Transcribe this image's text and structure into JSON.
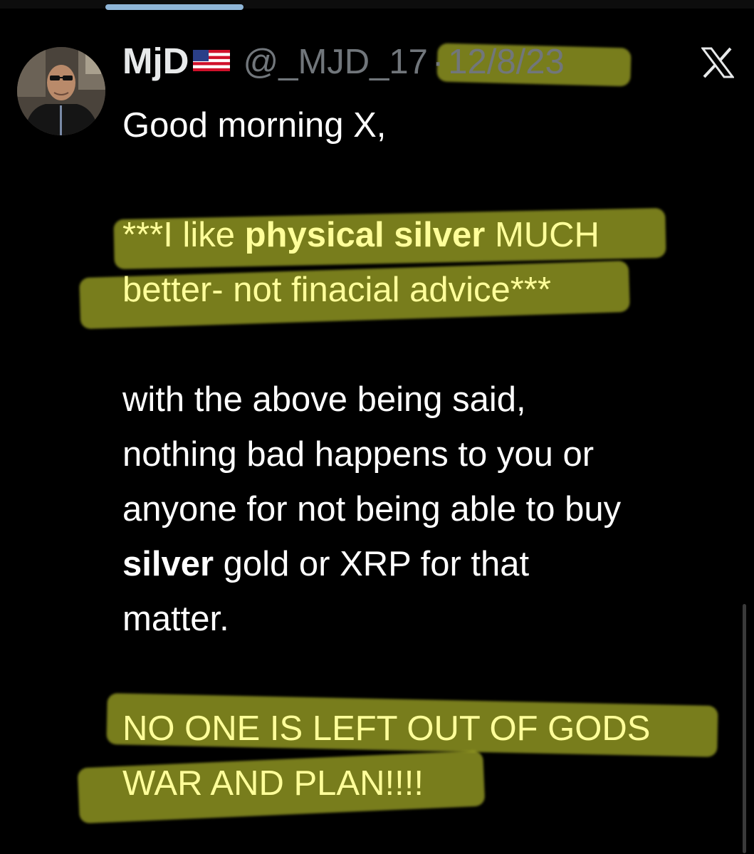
{
  "tweet": {
    "author_name": "MjD",
    "handle": "@_MJD_17",
    "separator": "·",
    "date": "12/8/23"
  },
  "post": {
    "line_greeting": "Good morning X,",
    "disclaimer_prefix": "***I like ",
    "disclaimer_bold": "physical silver",
    "disclaimer_mid": " MUCH",
    "disclaimer_line2": "better- not finacial advice***",
    "p2_line1": "with the above being said,",
    "p2_line2": "nothing bad happens to you or",
    "p2_line3": "anyone for not being able to buy",
    "p2_bold": "silver",
    "p2_line4_rest": " gold or XRP for that",
    "p2_line5": "matter.",
    "closing_line1": "NO ONE IS LEFT OUT OF GODS",
    "closing_line2": "WAR AND PLAN!!!!"
  },
  "icons": {
    "flag": "us-flag-icon",
    "logo": "x-logo-icon"
  },
  "colors": {
    "background": "#000000",
    "text": "#ffffff",
    "muted": "#71767b",
    "highlighter": "#e6ef37"
  }
}
